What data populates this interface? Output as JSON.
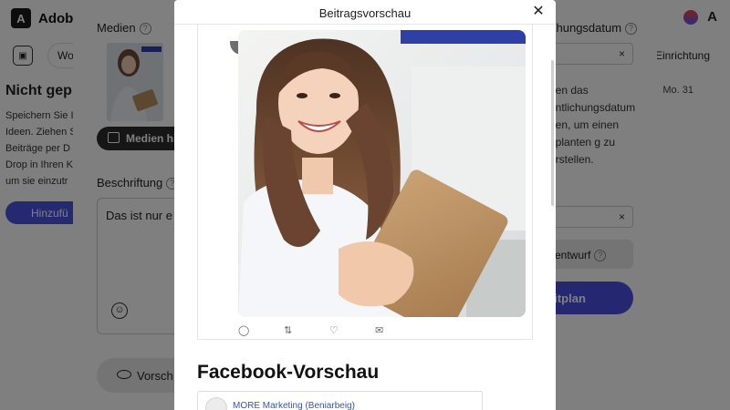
{
  "app": {
    "logo_glyph": "A",
    "brand": "Adobe",
    "subtab": "Woc",
    "subicon_glyph": "▣",
    "einrichtung": "Einrichtung",
    "left_title": "Nicht gep",
    "left_text": "Speichern Sie I Ideen. Ziehen S Beiträge per D Drop in Ihren K um sie einzutr",
    "left_button": "Hinzufü",
    "mo_label": "Mo. 31",
    "adobe_mark": "A"
  },
  "editor": {
    "media_label": "Medien",
    "help_glyph": "?",
    "media_button": "Medien hi",
    "caption_label": "Beschriftung",
    "caption_text": "Das ist nur e",
    "emoji_glyph": "☺",
    "preview_button": "Vorsch",
    "date_label": "chungsdatum",
    "input_clear": "×",
    "right_text": "nen das entlichungsdatum nen, um einen eplanten g zu erstellen.",
    "draft_button": "entwurf",
    "schedule_button": "eitplan"
  },
  "modal": {
    "title": "Beitragsvorschau",
    "close_glyph": "✕",
    "twitter_actions": {
      "reply_icon": "reply-icon",
      "retweet_icon": "retweet-icon",
      "like_icon": "heart-icon",
      "mail_icon": "mail-icon"
    },
    "facebook_title": "Facebook-Vorschau",
    "facebook_name": "MORE Marketing (Beniarbeig)"
  },
  "colors": {
    "accent": "#4b4fe0",
    "overlay": "rgba(0,0,0,0.5)",
    "photo_tag": "#2f3fa8"
  }
}
